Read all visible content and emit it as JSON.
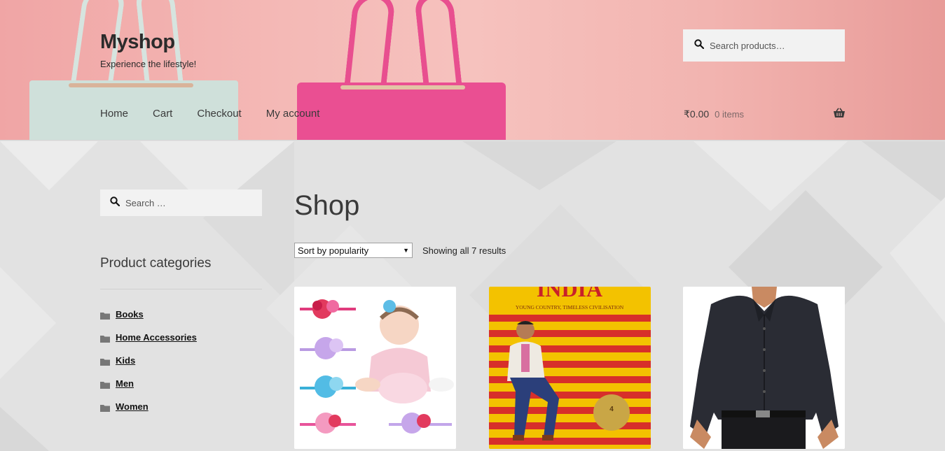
{
  "site": {
    "title": "Myshop",
    "tagline": "Experience the lifestyle!"
  },
  "nav": {
    "items": [
      {
        "label": "Home"
      },
      {
        "label": "Cart"
      },
      {
        "label": "Checkout"
      },
      {
        "label": "My account"
      }
    ]
  },
  "header_search": {
    "placeholder": "Search products…"
  },
  "cart": {
    "total": "₹0.00",
    "count": "0 items"
  },
  "sidebar": {
    "search_placeholder": "Search …",
    "categories_title": "Product categories",
    "categories": [
      {
        "label": "Books"
      },
      {
        "label": "Home Accessories"
      },
      {
        "label": "Kids"
      },
      {
        "label": "Men"
      },
      {
        "label": "Women"
      }
    ]
  },
  "main": {
    "page_title": "Shop",
    "sort_selected": "Sort by popularity",
    "result_count": "Showing all 7 results"
  },
  "products": [
    {
      "image": "headbands-baby"
    },
    {
      "image": "india-book-cover",
      "cover_title": "INDIA",
      "cover_subtitle": "YOUNG COUNTRY, TIMELESS CIVILISATION"
    },
    {
      "image": "dark-shirt"
    }
  ],
  "colors": {
    "accent_pink": "#ea4f92",
    "header_bg": "#f4b9b6",
    "text": "#3a3a3a"
  }
}
